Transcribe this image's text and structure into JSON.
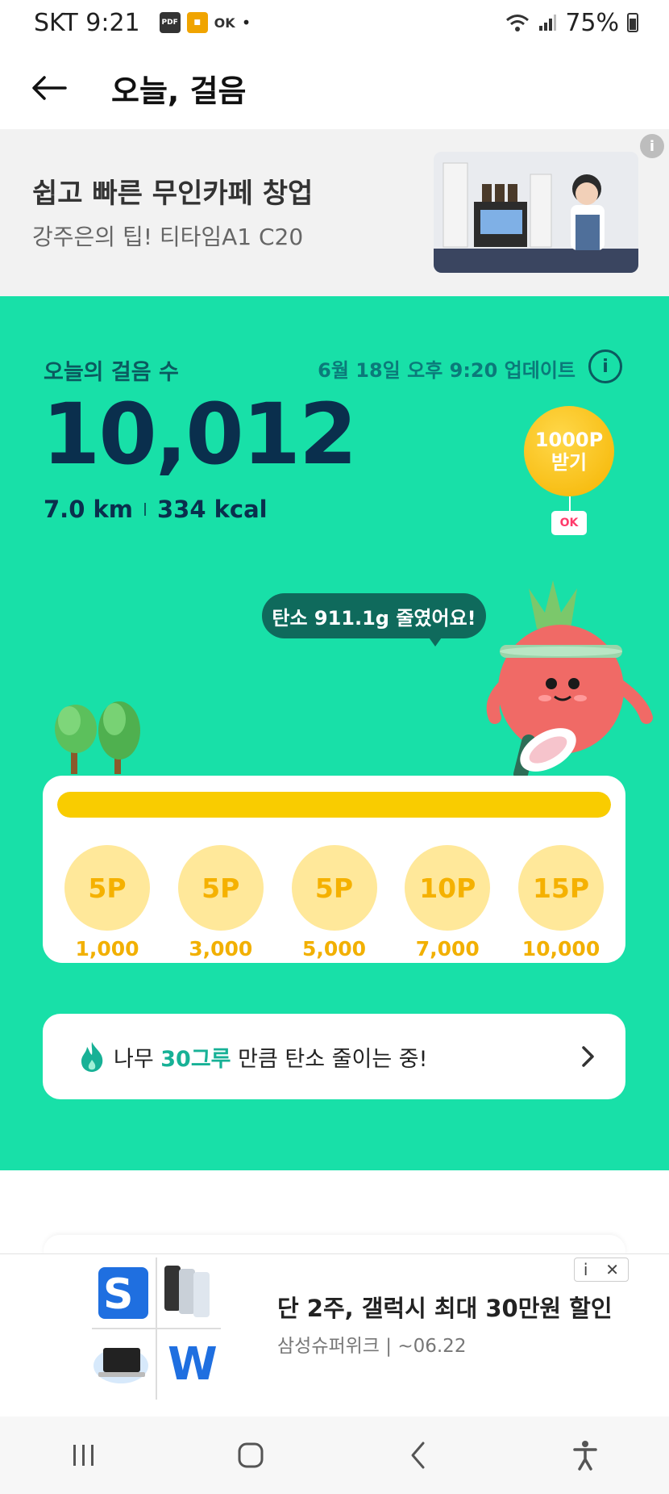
{
  "status_bar": {
    "carrier_time": "SKT 9:21",
    "notification_icons": [
      "pdf-icon",
      "app-icon",
      "ok-cashbag-icon"
    ],
    "dot": "•",
    "battery": "75%"
  },
  "header": {
    "title": "오늘, 걸음"
  },
  "ad_top": {
    "title": "쉽고 빠른 무인카페 창업",
    "subtitle": "강주은의 팁! 티타임A1 C20",
    "info": "i"
  },
  "steps": {
    "label": "오늘의 걸음 수",
    "updated": "6월 18일 오후 9:20 업데이트",
    "info": "i",
    "count": "10,012",
    "distance": "7.0 km",
    "calories": "334 kcal"
  },
  "reward_bubble": {
    "line1": "1000P",
    "line2": "받기",
    "tag": "OK"
  },
  "carbon": {
    "message": "탄소 911.1g 줄였어요!"
  },
  "progress": {
    "fraction": 1.0,
    "milestones": [
      {
        "points": "5P",
        "steps": "1,000"
      },
      {
        "points": "5P",
        "steps": "3,000"
      },
      {
        "points": "5P",
        "steps": "5,000"
      },
      {
        "points": "10P",
        "steps": "7,000"
      },
      {
        "points": "15P",
        "steps": "10,000"
      }
    ]
  },
  "tree_card": {
    "prefix": "나무 ",
    "highlight": "30그루",
    "suffix": " 만큼 탄소 줄이는 중!"
  },
  "ad_bottom": {
    "title": "단 2주, 갤럭시 최대 30만원 할인",
    "subtitle": "삼성슈퍼위크 | ~06.22",
    "info": "i",
    "close": "✕",
    "logo_letters": [
      "S",
      "W"
    ]
  },
  "colors": {
    "main_green": "#18e0a8",
    "progress_yellow": "#f9cc00",
    "steps_navy": "#0a2f4d",
    "highlight_teal": "#17b196"
  }
}
